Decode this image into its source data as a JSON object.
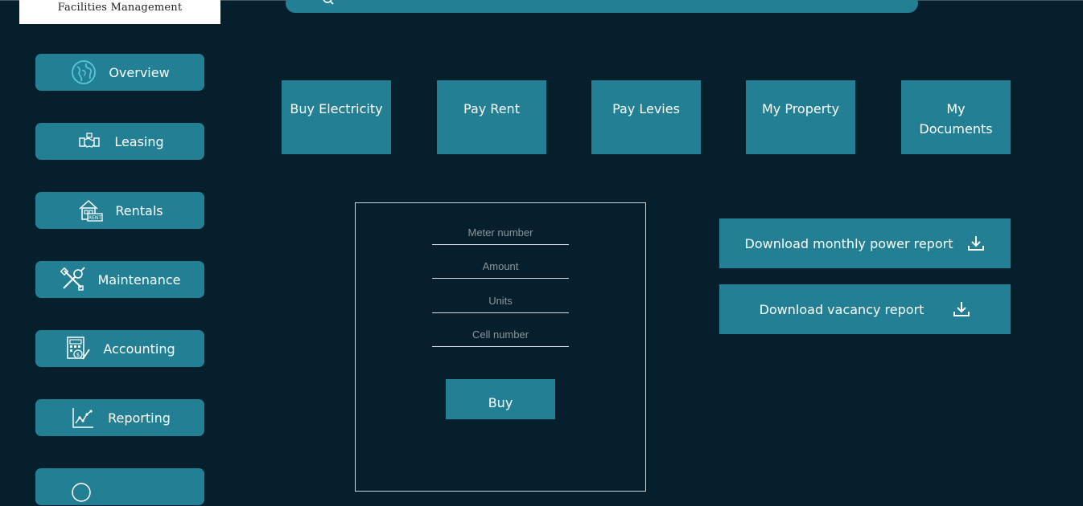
{
  "brand": {
    "logo_text": "Facilities Management"
  },
  "sidebar": {
    "items": [
      {
        "label": "Overview",
        "icon": "globe-icon"
      },
      {
        "label": "Leasing",
        "icon": "handshake-icon"
      },
      {
        "label": "Rentals",
        "icon": "house-rent-icon"
      },
      {
        "label": "Maintenance",
        "icon": "tools-icon"
      },
      {
        "label": "Accounting",
        "icon": "accounting-icon"
      },
      {
        "label": "Reporting",
        "icon": "chart-icon"
      }
    ]
  },
  "tiles": [
    {
      "label": "Buy Electricity"
    },
    {
      "label": "Pay Rent"
    },
    {
      "label": "Pay Levies"
    },
    {
      "label": "My Property"
    },
    {
      "label": "My Documents"
    }
  ],
  "electricity_form": {
    "meter_placeholder": "Meter number",
    "amount_placeholder": "Amount",
    "units_placeholder": "Units",
    "cell_placeholder": "Cell number",
    "buy_label": "Buy"
  },
  "reports": {
    "monthly_power_label": "Download monthly power report",
    "vacancy_label": "Download vacancy report"
  },
  "colors": {
    "background": "#05202c",
    "accent": "#237f93"
  }
}
